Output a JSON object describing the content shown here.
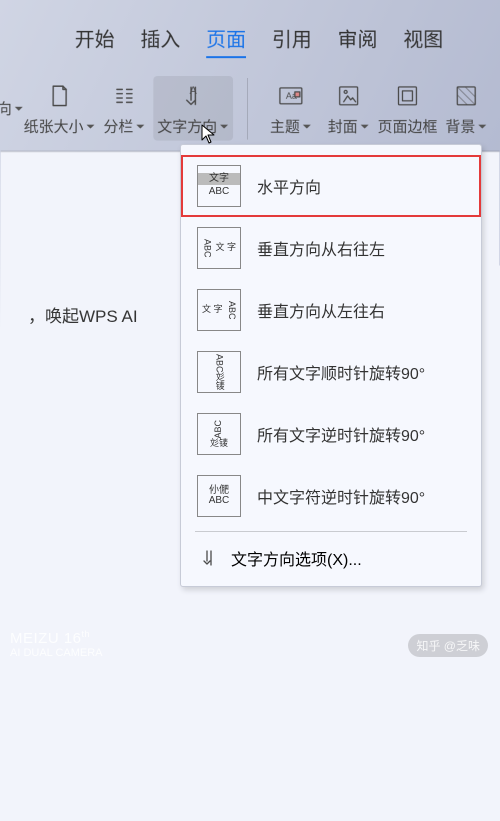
{
  "tabs": {
    "start": "开始",
    "insert": "插入",
    "page": "页面",
    "ref": "引用",
    "review": "审阅",
    "view": "视图"
  },
  "ribbon": {
    "orient_cut": "向",
    "paper_size": "纸张大小",
    "columns": "分栏",
    "text_dir": "文字方向",
    "theme": "主题",
    "cover": "封面",
    "border": "页面边框",
    "background": "背景"
  },
  "menu": {
    "horiz": "水平方向",
    "vert_rtl": "垂直方向从右往左",
    "vert_ltr": "垂直方向从左往右",
    "cw90": "所有文字顺时针旋转90°",
    "ccw90": "所有文字逆时针旋转90°",
    "cn_ccw90": "中文字符逆时针旋转90°",
    "options": "文字方向选项(X)..."
  },
  "thumb": {
    "wz": "文字",
    "abc": "ABC",
    "vwz": "文\n字",
    "abc_rot": "ᗅᗷᘓ",
    "wz_rot": "彣鿏",
    "mix": "仦俷"
  },
  "doc_hint": "，唤起WPS AI",
  "watermark": {
    "brand": "MEIZU 16",
    "brand_sup": "th",
    "camera": "AI DUAL CAMERA",
    "src": "知乎 @乏味"
  }
}
